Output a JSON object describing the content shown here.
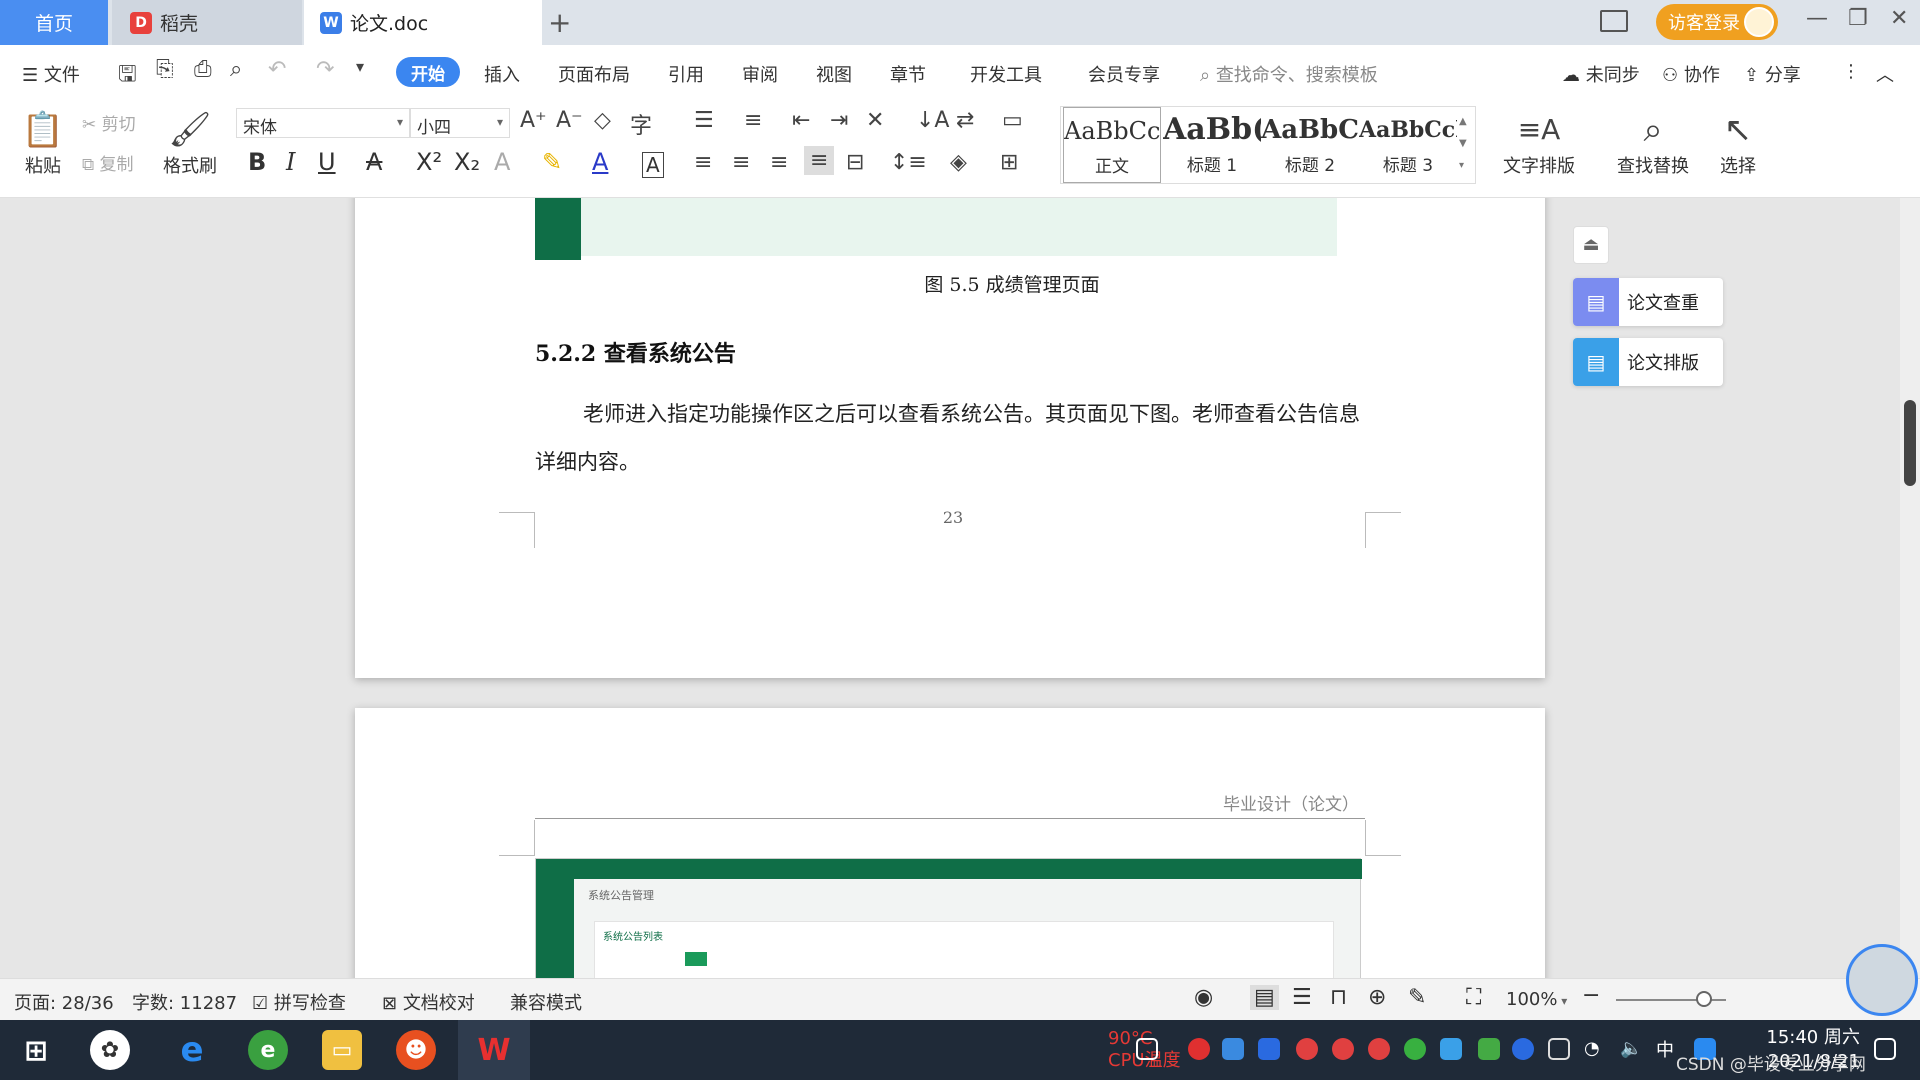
{
  "tabs": {
    "home": "首页",
    "docer": "稻壳",
    "doc": "论文.doc",
    "new_tab": "+",
    "login": "访客登录"
  },
  "menu": {
    "file": "文件",
    "start": "开始",
    "insert": "插入",
    "layout": "页面布局",
    "reference": "引用",
    "review": "审阅",
    "view": "视图",
    "section": "章节",
    "devtools": "开发工具",
    "member": "会员专享",
    "search": "查找命令、搜索模板",
    "unsync": "未同步",
    "collab": "协作",
    "share": "分享"
  },
  "ribbon": {
    "paste": "粘贴",
    "cut": "剪切",
    "copy": "复制",
    "format_painter": "格式刷",
    "font_name": "宋体",
    "font_size": "小四",
    "styles": [
      {
        "preview": "AaBbCcI",
        "label": "正文"
      },
      {
        "preview": "AaBb(",
        "label": "标题 1"
      },
      {
        "preview": "AaBbC",
        "label": "标题 2"
      },
      {
        "preview": "AaBbCcl",
        "label": "标题 3"
      }
    ],
    "text_layout": "文字排版",
    "find_replace": "查找替换",
    "select": "选择"
  },
  "document": {
    "caption": "图 5.5 成绩管理页面",
    "heading": "5.2.2  查看系统公告",
    "paragraph": "老师进入指定功能操作区之后可以查看系统公告。其页面见下图。老师查看公告信息详细内容。",
    "page_number": "23",
    "next_header": "毕业设计（论文）",
    "shot_title": "系统公告管理",
    "shot_card_title": "系统公告列表"
  },
  "side_panel": {
    "check": "论文查重",
    "format": "论文排版"
  },
  "status": {
    "page": "页面: 28/36",
    "words": "字数: 11287",
    "spell": "拼写检查",
    "proof": "文档校对",
    "compat": "兼容模式",
    "zoom": "100%",
    "zoom_level": 0.8
  },
  "taskbar": {
    "cpu": "90°C",
    "cpu_label": "CPU温度",
    "time": "15:40 周六",
    "date": "2021/8/21",
    "ime": "中",
    "watermark": "CSDN @毕设专业分享网"
  },
  "colors": {
    "accent": "#3b86f0",
    "green": "#0f6e47",
    "login": "#f0a020"
  }
}
